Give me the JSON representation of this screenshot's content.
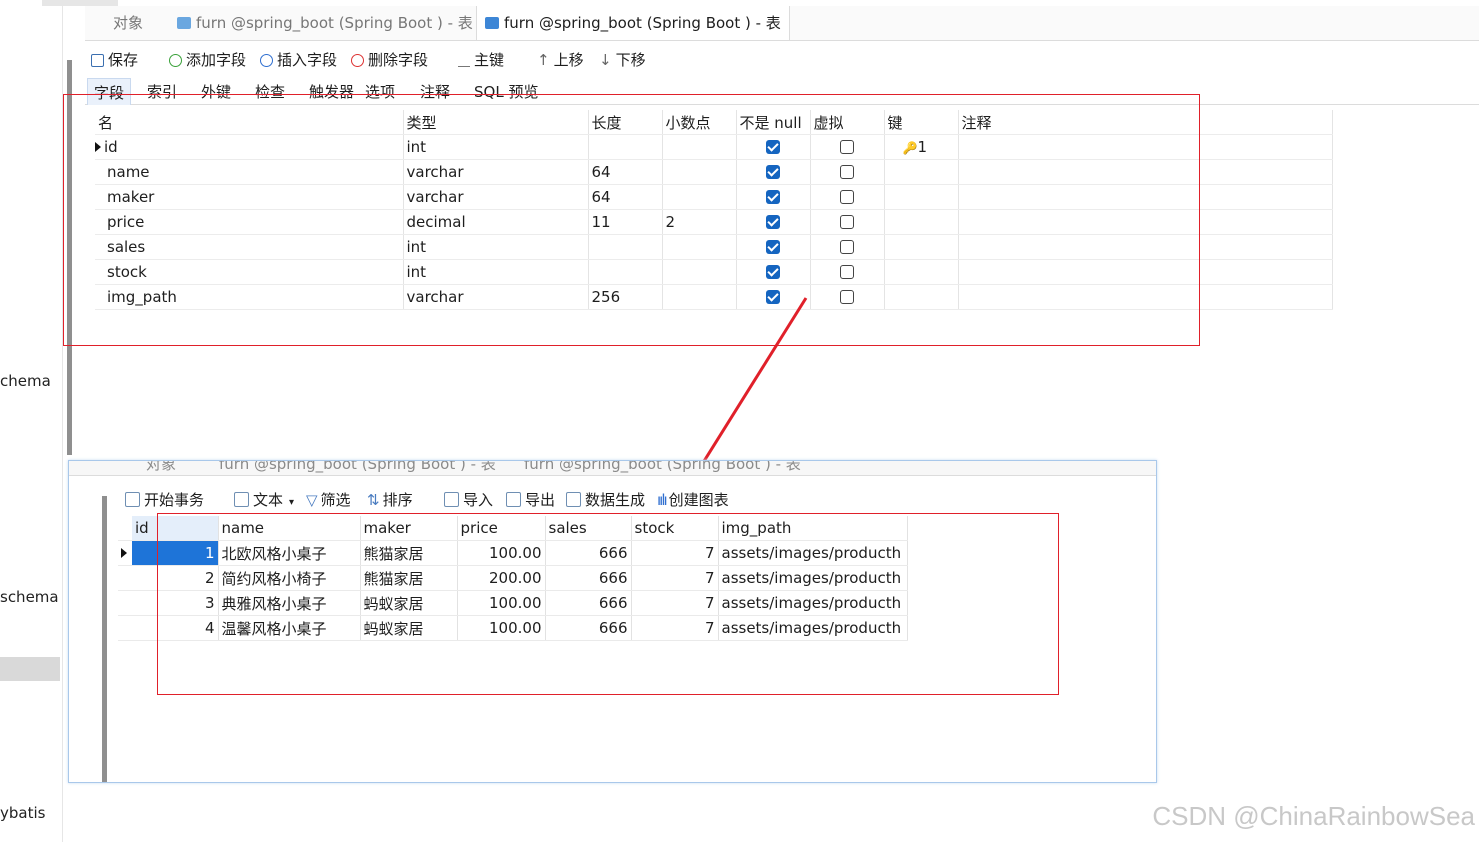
{
  "sidebar": {
    "items": [
      "chema",
      "schema",
      "ybatis"
    ]
  },
  "top_tabs": [
    {
      "label": "对象"
    },
    {
      "label": "furn @spring_boot (Spring Boot ) - 表"
    },
    {
      "label": "furn @spring_boot (Spring Boot ) - 表"
    }
  ],
  "toolbar": {
    "save": "保存",
    "add_field": "添加字段",
    "insert_field": "插入字段",
    "delete_field": "删除字段",
    "primary_key": "主键",
    "move_up": "上移",
    "move_down": "下移"
  },
  "subtabs": [
    "字段",
    "索引",
    "外键",
    "检查",
    "触发器",
    "选项",
    "注释",
    "SQL 预览"
  ],
  "fields_table": {
    "headers": [
      "名",
      "类型",
      "长度",
      "小数点",
      "不是 null",
      "虚拟",
      "键",
      "注释"
    ],
    "rows": [
      {
        "name": "id",
        "type": "int",
        "length": "",
        "decimals": "",
        "not_null": true,
        "virtual": false,
        "key": "1"
      },
      {
        "name": "name",
        "type": "varchar",
        "length": "64",
        "decimals": "",
        "not_null": true,
        "virtual": false,
        "key": ""
      },
      {
        "name": "maker",
        "type": "varchar",
        "length": "64",
        "decimals": "",
        "not_null": true,
        "virtual": false,
        "key": ""
      },
      {
        "name": "price",
        "type": "decimal",
        "length": "11",
        "decimals": "2",
        "not_null": true,
        "virtual": false,
        "key": ""
      },
      {
        "name": "sales",
        "type": "int",
        "length": "",
        "decimals": "",
        "not_null": true,
        "virtual": false,
        "key": ""
      },
      {
        "name": "stock",
        "type": "int",
        "length": "",
        "decimals": "",
        "not_null": true,
        "virtual": false,
        "key": ""
      },
      {
        "name": "img_path",
        "type": "varchar",
        "length": "256",
        "decimals": "",
        "not_null": true,
        "virtual": false,
        "key": ""
      }
    ]
  },
  "bottom_tabs": [
    {
      "label": "对象"
    },
    {
      "label": "furn @spring_boot (Spring Boot ) - 表"
    },
    {
      "label": "furn @spring_boot (Spring Boot ) - 表"
    }
  ],
  "bottom_toolbar": {
    "begin_tx": "开始事务",
    "text": "文本",
    "filter": "筛选",
    "sort": "排序",
    "import": "导入",
    "export": "导出",
    "generate": "数据生成",
    "create_chart": "创建图表"
  },
  "data_table": {
    "headers": [
      "id",
      "name",
      "maker",
      "price",
      "sales",
      "stock",
      "img_path"
    ],
    "rows": [
      {
        "id": "1",
        "name": "北欧风格小桌子",
        "maker": "熊猫家居",
        "price": "100.00",
        "sales": "666",
        "stock": "7",
        "img_path": "assets/images/producth"
      },
      {
        "id": "2",
        "name": "简约风格小椅子",
        "maker": "熊猫家居",
        "price": "200.00",
        "sales": "666",
        "stock": "7",
        "img_path": "assets/images/producth"
      },
      {
        "id": "3",
        "name": "典雅风格小桌子",
        "maker": "蚂蚁家居",
        "price": "100.00",
        "sales": "666",
        "stock": "7",
        "img_path": "assets/images/producth"
      },
      {
        "id": "4",
        "name": "温馨风格小桌子",
        "maker": "蚂蚁家居",
        "price": "100.00",
        "sales": "666",
        "stock": "7",
        "img_path": "assets/images/producth"
      }
    ]
  },
  "watermark": "CSDN @ChinaRainbowSea",
  "colors": {
    "annotation_red": "#e0202a",
    "check_blue": "#1565c0",
    "selection_blue": "#1e74d8"
  }
}
